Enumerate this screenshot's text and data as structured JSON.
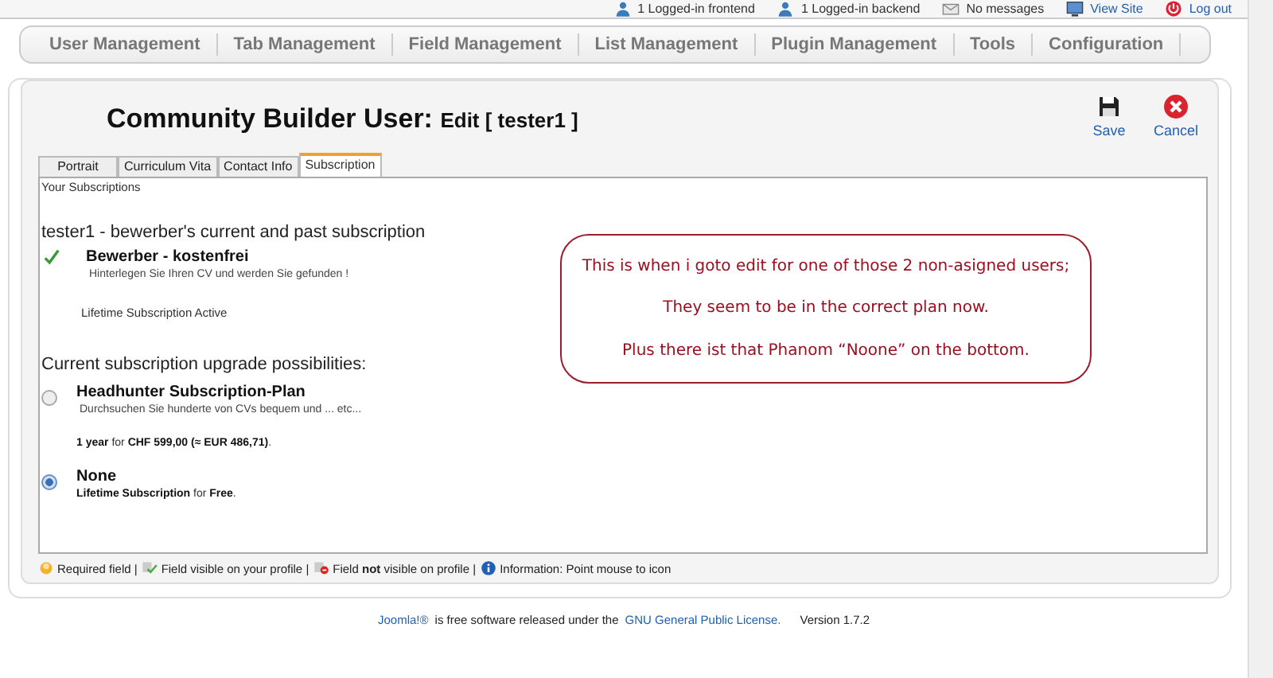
{
  "top_bar": [
    {
      "kind": "users",
      "label": "1 Logged-in frontend"
    },
    {
      "kind": "users",
      "label": "1 Logged-in backend"
    },
    {
      "kind": "mail",
      "label": "No messages"
    },
    {
      "kind": "site",
      "label": "View Site"
    },
    {
      "kind": "logout",
      "label": "Log out"
    }
  ],
  "menu": [
    "User Management",
    "Tab Management",
    "Field Management",
    "List Management",
    "Plugin Management",
    "Tools",
    "Configuration"
  ],
  "header": {
    "title": "Community Builder User:",
    "subtitle": "Edit [ tester1 ]"
  },
  "toolbar": [
    {
      "kind": "save",
      "label": "Save"
    },
    {
      "kind": "cancel",
      "label": "Cancel"
    }
  ],
  "tabs": [
    {
      "label": "Portrait",
      "selected": false
    },
    {
      "label": "Curriculum Vita",
      "selected": false
    },
    {
      "label": "Contact Info",
      "selected": false
    },
    {
      "label": "Subscription",
      "selected": true
    }
  ],
  "tab_content": {
    "heading": "Your Subscriptions",
    "current_title": "tester1 - bewerber's current and past subscription",
    "current_plan": {
      "name": "Bewerber - kostenfrei",
      "description": "Hinterlegen Sie Ihren CV und werden Sie gefunden !",
      "status": "Lifetime Subscription Active"
    },
    "upgrade_title": "Current subscription upgrade possibilities:",
    "options": [
      {
        "name": "Headhunter Subscription-Plan",
        "description": "Durchsuchen Sie hunderte von CVs bequem und ... etc...",
        "price": "**1 year** for **CHF 599,00 (≈ EUR 486,71)**.",
        "selected": false
      },
      {
        "name": "None",
        "price": "**Lifetime Subscription** for **Free**.",
        "selected": true
      }
    ]
  },
  "legend": [
    {
      "kind": "required",
      "text": "Required field |"
    },
    {
      "kind": "visible",
      "text": "Field visible on your profile |"
    },
    {
      "kind": "hidden",
      "text": "Field **not** visible on profile |"
    },
    {
      "kind": "info",
      "text": "Information: Point mouse to icon"
    }
  ],
  "annotation": {
    "lines": [
      "This is when i goto edit for one of those 2 non-asigned users;",
      "They seem to be in the correct plan now.",
      "Plus there ist that Phanom “Noone” on the bottom."
    ]
  },
  "footer": [
    {
      "kind": "link",
      "text": "Joomla!®"
    },
    {
      "kind": "text",
      "text": "is free software released under the"
    },
    {
      "kind": "link",
      "text": "GNU General Public License."
    },
    {
      "kind": "text",
      "text": "Version 1.7.2"
    }
  ]
}
